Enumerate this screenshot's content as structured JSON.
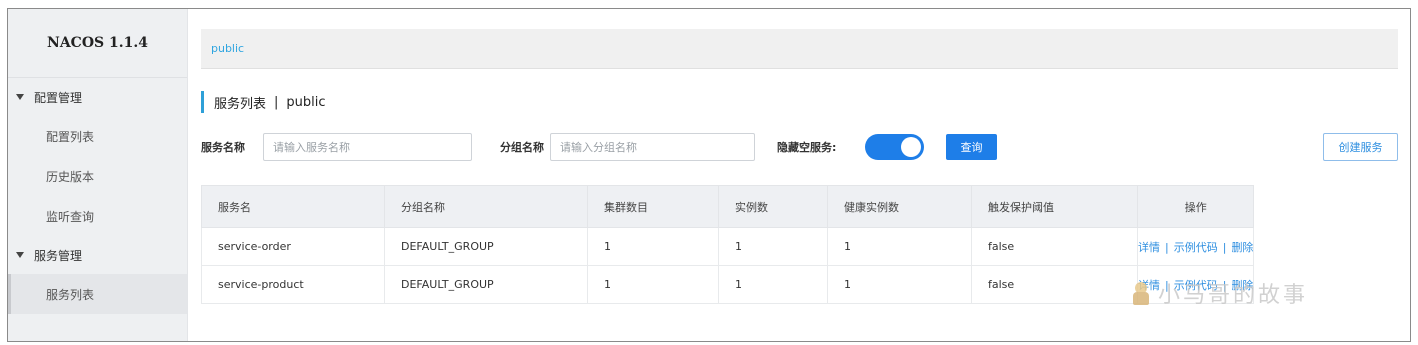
{
  "sidebar": {
    "brand": "NACOS 1.1.4",
    "groups": [
      {
        "label": "配置管理",
        "items": [
          "配置列表",
          "历史版本",
          "监听查询"
        ]
      },
      {
        "label": "服务管理",
        "items": [
          "服务列表"
        ]
      }
    ],
    "active_item": "服务列表"
  },
  "namespace": {
    "current": "public"
  },
  "page": {
    "title": "服务列表",
    "separator": "|",
    "namespace": "public"
  },
  "filters": {
    "service_label": "服务名称",
    "service_placeholder": "请输入服务名称",
    "group_label": "分组名称",
    "group_placeholder": "请输入分组名称",
    "hide_empty_label": "隐藏空服务:",
    "hide_empty_on": true,
    "query_button": "查询",
    "create_button": "创建服务"
  },
  "table": {
    "headers": [
      "服务名",
      "分组名称",
      "集群数目",
      "实例数",
      "健康实例数",
      "触发保护阈值",
      "操作"
    ],
    "rows": [
      {
        "name": "service-order",
        "group": "DEFAULT_GROUP",
        "clusters": "1",
        "instances": "1",
        "healthy": "1",
        "threshold": "false"
      },
      {
        "name": "service-product",
        "group": "DEFAULT_GROUP",
        "clusters": "1",
        "instances": "1",
        "healthy": "1",
        "threshold": "false"
      }
    ],
    "actions": {
      "detail": "详情",
      "sample": "示例代码",
      "delete": "删除",
      "sep": "|"
    }
  },
  "watermark": "小马哥的故事",
  "colors": {
    "accent": "#1e7ee8",
    "link": "#2f8fe0",
    "namespace_link": "#2fa5e0",
    "sidebar_bg": "#eef0f2"
  }
}
